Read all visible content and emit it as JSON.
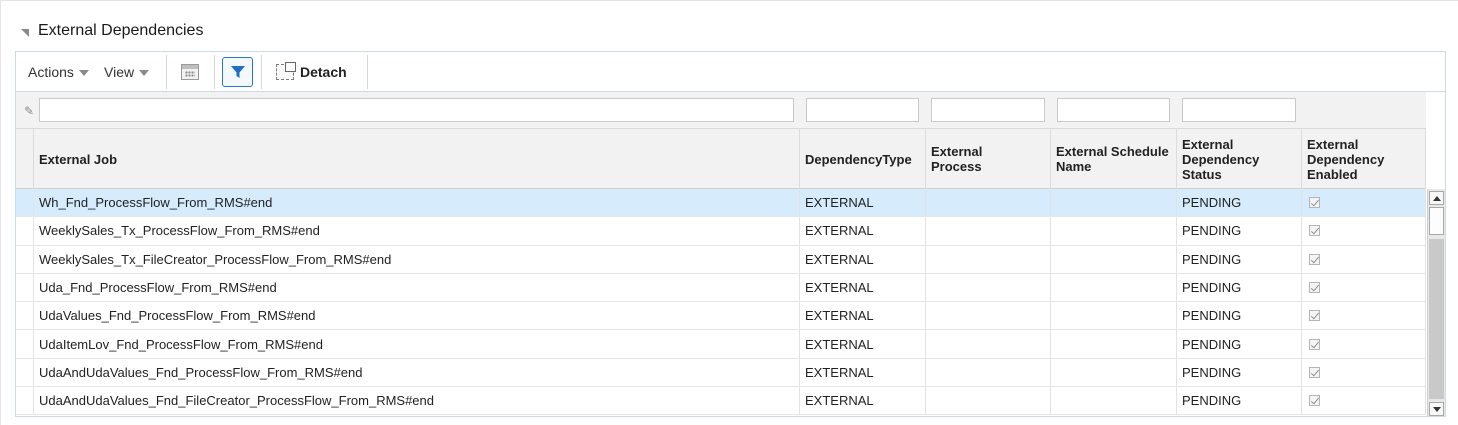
{
  "panel": {
    "title": "External Dependencies"
  },
  "toolbar": {
    "actions_label": "Actions",
    "view_label": "View",
    "detach_label": "Detach"
  },
  "table": {
    "columns": [
      "External Job",
      "DependencyType",
      "External Process",
      "External Schedule Name",
      "External Dependency Status",
      "External Dependency Enabled"
    ],
    "rows": [
      {
        "job": "Wh_Fnd_ProcessFlow_From_RMS#end",
        "type": "EXTERNAL",
        "process": "",
        "schedule": "",
        "status": "PENDING",
        "enabled": true
      },
      {
        "job": "WeeklySales_Tx_ProcessFlow_From_RMS#end",
        "type": "EXTERNAL",
        "process": "",
        "schedule": "",
        "status": "PENDING",
        "enabled": true
      },
      {
        "job": "WeeklySales_Tx_FileCreator_ProcessFlow_From_RMS#end",
        "type": "EXTERNAL",
        "process": "",
        "schedule": "",
        "status": "PENDING",
        "enabled": true
      },
      {
        "job": "Uda_Fnd_ProcessFlow_From_RMS#end",
        "type": "EXTERNAL",
        "process": "",
        "schedule": "",
        "status": "PENDING",
        "enabled": true
      },
      {
        "job": "UdaValues_Fnd_ProcessFlow_From_RMS#end",
        "type": "EXTERNAL",
        "process": "",
        "schedule": "",
        "status": "PENDING",
        "enabled": true
      },
      {
        "job": "UdaItemLov_Fnd_ProcessFlow_From_RMS#end",
        "type": "EXTERNAL",
        "process": "",
        "schedule": "",
        "status": "PENDING",
        "enabled": true
      },
      {
        "job": "UdaAndUdaValues_Fnd_ProcessFlow_From_RMS#end",
        "type": "EXTERNAL",
        "process": "",
        "schedule": "",
        "status": "PENDING",
        "enabled": true
      },
      {
        "job": "UdaAndUdaValues_Fnd_FileCreator_ProcessFlow_From_RMS#end",
        "type": "EXTERNAL",
        "process": "",
        "schedule": "",
        "status": "PENDING",
        "enabled": true
      }
    ],
    "selected_row": 0
  },
  "colors": {
    "selected_row": "#d6ebfb",
    "accent": "#2a77c9",
    "header_bg": "#f2f2f2"
  }
}
